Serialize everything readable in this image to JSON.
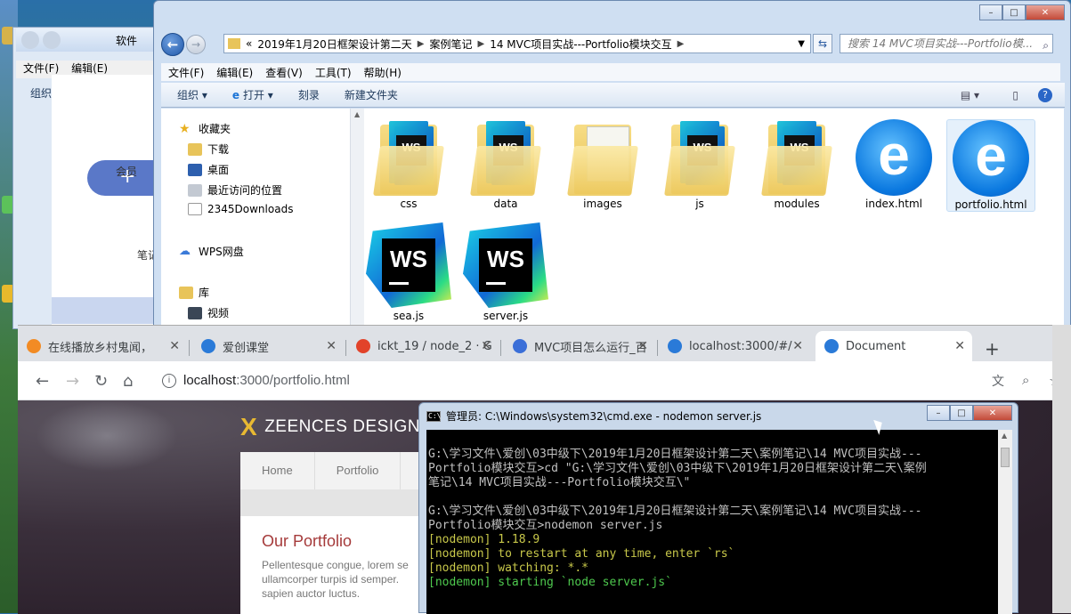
{
  "desktop": {
    "bg_window": {
      "address_crumb": "软件",
      "menu": [
        "文件(F)",
        "编辑(E)"
      ],
      "organize": "组织",
      "sidebar_label": "会员",
      "note_label": "笔记"
    }
  },
  "explorer": {
    "title_buttons": [
      "–",
      "□",
      "✕"
    ],
    "breadcrumb": [
      "«",
      "2019年1月20日框架设计第二天",
      "案例笔记",
      "14 MVC项目实战---Portfolio模块交互"
    ],
    "search_placeholder": "搜索 14 MVC项目实战---Portfolio模...",
    "menu": [
      "文件(F)",
      "编辑(E)",
      "查看(V)",
      "工具(T)",
      "帮助(H)"
    ],
    "commands": [
      "组织 ▾",
      "打开 ▾",
      "刻录",
      "新建文件夹"
    ],
    "nav": {
      "favorites": "收藏夹",
      "downloads": "下载",
      "desktop": "桌面",
      "recent": "最近访问的位置",
      "custom": "2345Downloads",
      "wps": "WPS网盘",
      "library": "库",
      "video": "视频"
    },
    "files": [
      {
        "name": "css",
        "type": "folder-ws"
      },
      {
        "name": "data",
        "type": "folder-ws"
      },
      {
        "name": "images",
        "type": "folder-img"
      },
      {
        "name": "js",
        "type": "folder-ws"
      },
      {
        "name": "modules",
        "type": "folder-ws"
      },
      {
        "name": "index.html",
        "type": "ie"
      },
      {
        "name": "portfolio.html",
        "type": "ie"
      },
      {
        "name": "sea.js",
        "type": "ws"
      },
      {
        "name": "server.js",
        "type": "ws"
      }
    ]
  },
  "browser": {
    "tabs": [
      {
        "title": "在线播放乡村鬼闻，",
        "icon_color": "#f28b24"
      },
      {
        "title": "爱创课堂",
        "icon_color": "#2a7ad8"
      },
      {
        "title": "ickt_19 / node_2 · G",
        "icon_color": "#e2432a"
      },
      {
        "title": "MVC项目怎么运行_百",
        "icon_color": "#3b6fd8"
      },
      {
        "title": "localhost:3000/#/",
        "icon_color": "#2a7ad8"
      },
      {
        "title": "Document",
        "icon_color": "#2a7ad8"
      }
    ],
    "new_tab": "+",
    "url_host": "localhost",
    "url_path": ":3000/portfolio.html",
    "page": {
      "logo_mark": "X",
      "logo_text": "ZEENCES DESIGN",
      "nav": [
        "Home",
        "Portfolio"
      ],
      "heading": "Our Portfolio",
      "body_lines": [
        "Pellentesque congue, lorem se",
        "ullamcorper turpis id semper. ",
        "sapien auctor luctus."
      ]
    }
  },
  "cmd": {
    "title": "管理员: C:\\Windows\\system32\\cmd.exe - nodemon  server.js",
    "lines": [
      {
        "text": "",
        "cls": ""
      },
      {
        "text": "G:\\学习文件\\爱创\\03中级下\\2019年1月20日框架设计第二天\\案例笔记\\14 MVC项目实战---",
        "cls": ""
      },
      {
        "text": "Portfolio模块交互>cd \"G:\\学习文件\\爱创\\03中级下\\2019年1月20日框架设计第二天\\案例",
        "cls": ""
      },
      {
        "text": "笔记\\14 MVC项目实战---Portfolio模块交互\\\"",
        "cls": ""
      },
      {
        "text": "",
        "cls": ""
      },
      {
        "text": "G:\\学习文件\\爱创\\03中级下\\2019年1月20日框架设计第二天\\案例笔记\\14 MVC项目实战---",
        "cls": ""
      },
      {
        "text": "Portfolio模块交互>nodemon server.js",
        "cls": ""
      },
      {
        "text": "[nodemon] 1.18.9",
        "cls": "y"
      },
      {
        "text": "[nodemon] to restart at any time, enter `rs`",
        "cls": "y"
      },
      {
        "text": "[nodemon] watching: *.*",
        "cls": "y"
      },
      {
        "text": "[nodemon] starting `node server.js`",
        "cls": "g"
      },
      {
        "text": "",
        "cls": ""
      },
      {
        "text": "_",
        "cls": ""
      }
    ]
  }
}
